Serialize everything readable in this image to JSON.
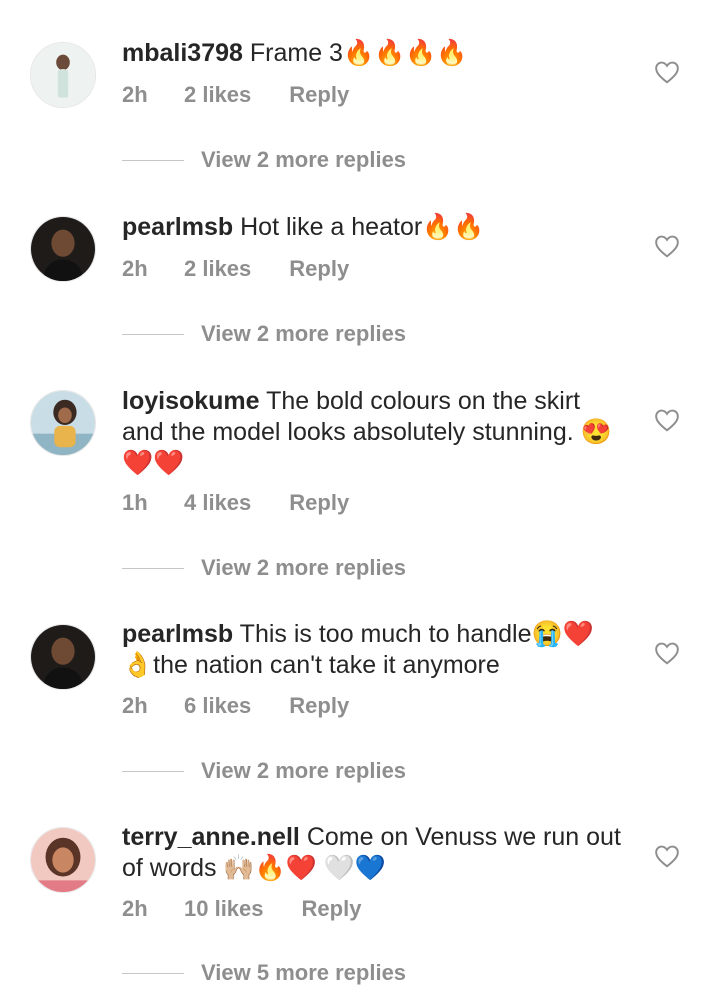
{
  "comments": [
    {
      "username": "mbali3798",
      "text": "Frame 3🔥🔥🔥🔥",
      "time": "2h",
      "likes": "2 likes",
      "reply": "Reply",
      "view_replies": "View 2 more replies"
    },
    {
      "username": "pearlmsb",
      "text": "Hot like a heator🔥🔥",
      "time": "2h",
      "likes": "2 likes",
      "reply": "Reply",
      "view_replies": "View 2 more replies"
    },
    {
      "username": "loyisokume",
      "text": "The bold colours on the skirt and the model looks absolutely stunning. 😍❤️❤️",
      "time": "1h",
      "likes": "4 likes",
      "reply": "Reply",
      "view_replies": "View 2 more replies"
    },
    {
      "username": "pearlmsb",
      "text": "This is too much to handle😭❤️ 👌the nation can't take it anymore",
      "time": "2h",
      "likes": "6 likes",
      "reply": "Reply",
      "view_replies": "View 2 more replies"
    },
    {
      "username": "terry_anne.nell",
      "text": "Come on Venuss we run out of words 🙌🏼🔥❤️ 🤍💙",
      "time": "2h",
      "likes": "10 likes",
      "reply": "Reply",
      "view_replies": "View 5 more replies"
    }
  ],
  "icons": {
    "like": "heart-outline-icon"
  },
  "colors": {
    "text": "#262626",
    "secondary": "#8e8e8e",
    "divider": "#c7c7c7"
  }
}
